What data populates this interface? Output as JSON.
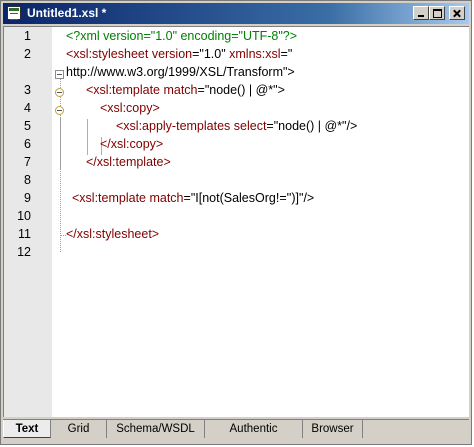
{
  "window": {
    "title": "Untitled1.xsl *"
  },
  "editor": {
    "lines": [
      {
        "number": "1",
        "tokens": [
          {
            "t": "pi",
            "text": "<?xml version=\"1.0\" encoding=\"UTF-8\"?>"
          }
        ]
      },
      {
        "number": "2",
        "tokens": [
          {
            "t": "tag",
            "text": "<xsl:stylesheet "
          },
          {
            "t": "attr",
            "text": "version"
          },
          {
            "t": "val",
            "text": "=\"1.0\" "
          },
          {
            "t": "attr",
            "text": "xmlns:xsl"
          },
          {
            "t": "val",
            "text": "=\""
          }
        ]
      },
      {
        "number": "",
        "tokens": [
          {
            "t": "val",
            "text": "http://www.w3.org/1999/XSL/Transform\">"
          }
        ]
      },
      {
        "number": "3",
        "tokens": [
          {
            "t": "tag",
            "text": "<xsl:template "
          },
          {
            "t": "attr",
            "text": "match"
          },
          {
            "t": "val",
            "text": "=\"node() | @*\">"
          }
        ]
      },
      {
        "number": "4",
        "tokens": [
          {
            "t": "tag",
            "text": "<xsl:copy>"
          }
        ]
      },
      {
        "number": "5",
        "tokens": [
          {
            "t": "tag",
            "text": "<xsl:apply-templates "
          },
          {
            "t": "attr",
            "text": "select"
          },
          {
            "t": "val",
            "text": "=\"node() | @*\"/>"
          }
        ]
      },
      {
        "number": "6",
        "tokens": [
          {
            "t": "tag",
            "text": "</xsl:copy>"
          }
        ]
      },
      {
        "number": "7",
        "tokens": [
          {
            "t": "tag",
            "text": "</xsl:template>"
          }
        ]
      },
      {
        "number": "8",
        "tokens": []
      },
      {
        "number": "9",
        "tokens": [
          {
            "t": "tag",
            "text": "<xsl:template "
          },
          {
            "t": "attr",
            "text": "match"
          },
          {
            "t": "val",
            "text": "=\"I[not(SalesOrg!='')]\"/>"
          }
        ]
      },
      {
        "number": "10",
        "tokens": []
      },
      {
        "number": "11",
        "tokens": [
          {
            "t": "tag",
            "text": "</xsl:stylesheet>"
          }
        ]
      },
      {
        "number": "12",
        "tokens": []
      }
    ]
  },
  "tabs": [
    {
      "label": "Text",
      "active": true
    },
    {
      "label": "Grid",
      "active": false
    },
    {
      "label": "Schema/WSDL",
      "active": false
    },
    {
      "label": "Authentic",
      "active": false
    },
    {
      "label": "Browser",
      "active": false
    }
  ],
  "colors": {
    "titlebar": "#0a246a",
    "processing_instruction": "#008000",
    "tag": "#800000",
    "attribute_value": "#000000"
  }
}
